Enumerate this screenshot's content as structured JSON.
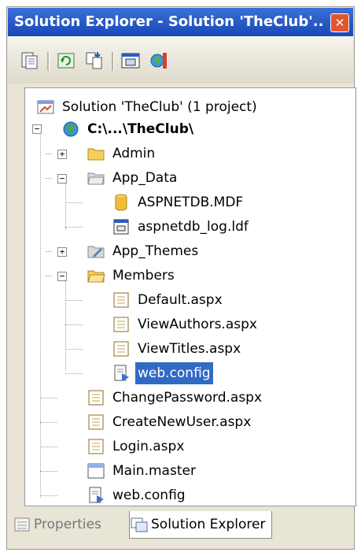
{
  "window": {
    "title": "Solution Explorer - Solution 'TheClub'...",
    "close_glyph": "✕"
  },
  "toolbar": {
    "buttons": [
      "properties-icon",
      "refresh-icon",
      "nest-related-files-icon",
      "view-designer-icon",
      "asp-net-configuration-icon"
    ]
  },
  "tree": {
    "solution": "Solution 'TheClub' (1 project)",
    "project": "C:\\...\\TheClub\\",
    "items": {
      "admin": "Admin",
      "app_data": "App_Data",
      "aspnetdb_mdf": "ASPNETDB.MDF",
      "aspnetdb_log": "aspnetdb_log.ldf",
      "app_themes": "App_Themes",
      "members": "Members",
      "default": "Default.aspx",
      "view_authors": "ViewAuthors.aspx",
      "view_titles": "ViewTitles.aspx",
      "members_web_config": "web.config",
      "change_password": "ChangePassword.aspx",
      "create_new_user": "CreateNewUser.aspx",
      "login": "Login.aspx",
      "main_master": "Main.master",
      "web_config": "web.config"
    },
    "selected": "members_web_config"
  },
  "tabs": {
    "properties": "Properties",
    "solution_explorer": "Solution Explorer",
    "active": "solution_explorer"
  },
  "colors": {
    "titlebar": "#2554c7",
    "selection": "#316ac5",
    "folder": "#f5cf59"
  }
}
